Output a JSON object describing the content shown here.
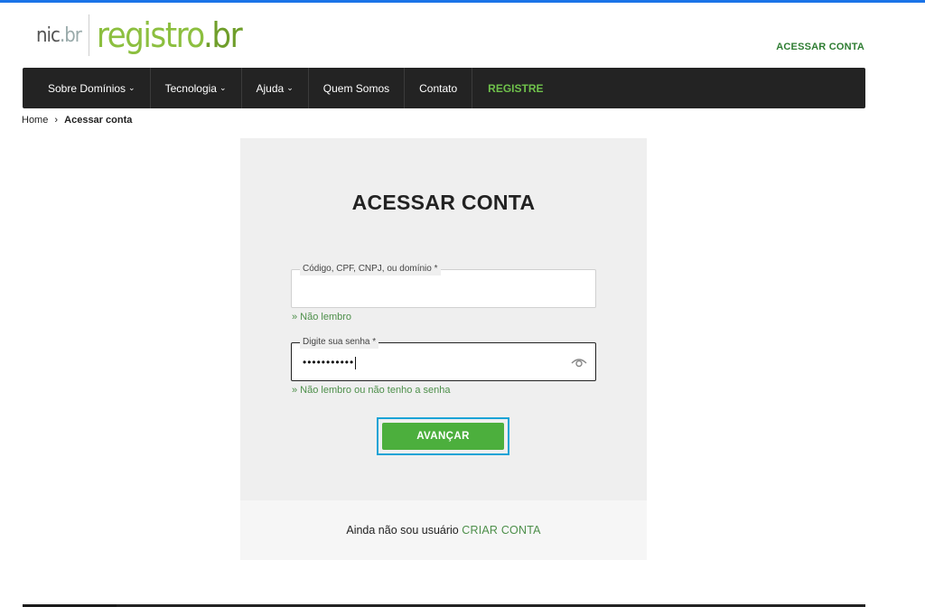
{
  "header": {
    "logo": {
      "nic": "nic",
      "nic_suffix": ".br",
      "brand": "registro",
      "brand_suffix": ".br"
    },
    "login_link": "ACESSAR CONTA"
  },
  "nav": {
    "items": [
      {
        "label": "Sobre Domínios",
        "dropdown": true
      },
      {
        "label": "Tecnologia",
        "dropdown": true
      },
      {
        "label": "Ajuda",
        "dropdown": true
      },
      {
        "label": "Quem Somos",
        "dropdown": false
      },
      {
        "label": "Contato",
        "dropdown": false
      },
      {
        "label": "REGISTRE",
        "dropdown": false
      }
    ],
    "chevron": "⌄"
  },
  "breadcrumb": {
    "home": "Home",
    "separator": "›",
    "current": "Acessar conta"
  },
  "login": {
    "title": "ACESSAR CONTA",
    "id_field": {
      "label": "Código, CPF, CNPJ, ou domínio *",
      "value": ""
    },
    "id_help": "» Não lembro",
    "password_field": {
      "label": "Digite sua senha *",
      "value": "•••••••••••"
    },
    "password_help": "» Não lembro ou não tenho a senha",
    "submit": "AVANÇAR",
    "eye_icon": "eye-icon"
  },
  "footer": {
    "text": "Ainda não sou usuário",
    "link": "CRIAR CONTA"
  },
  "colors": {
    "accent": "#4caf3d",
    "brand": "#8cbf3f",
    "nav_bg": "#232323",
    "link": "#4d8f4a",
    "focus_ring": "#1aa3d6"
  }
}
